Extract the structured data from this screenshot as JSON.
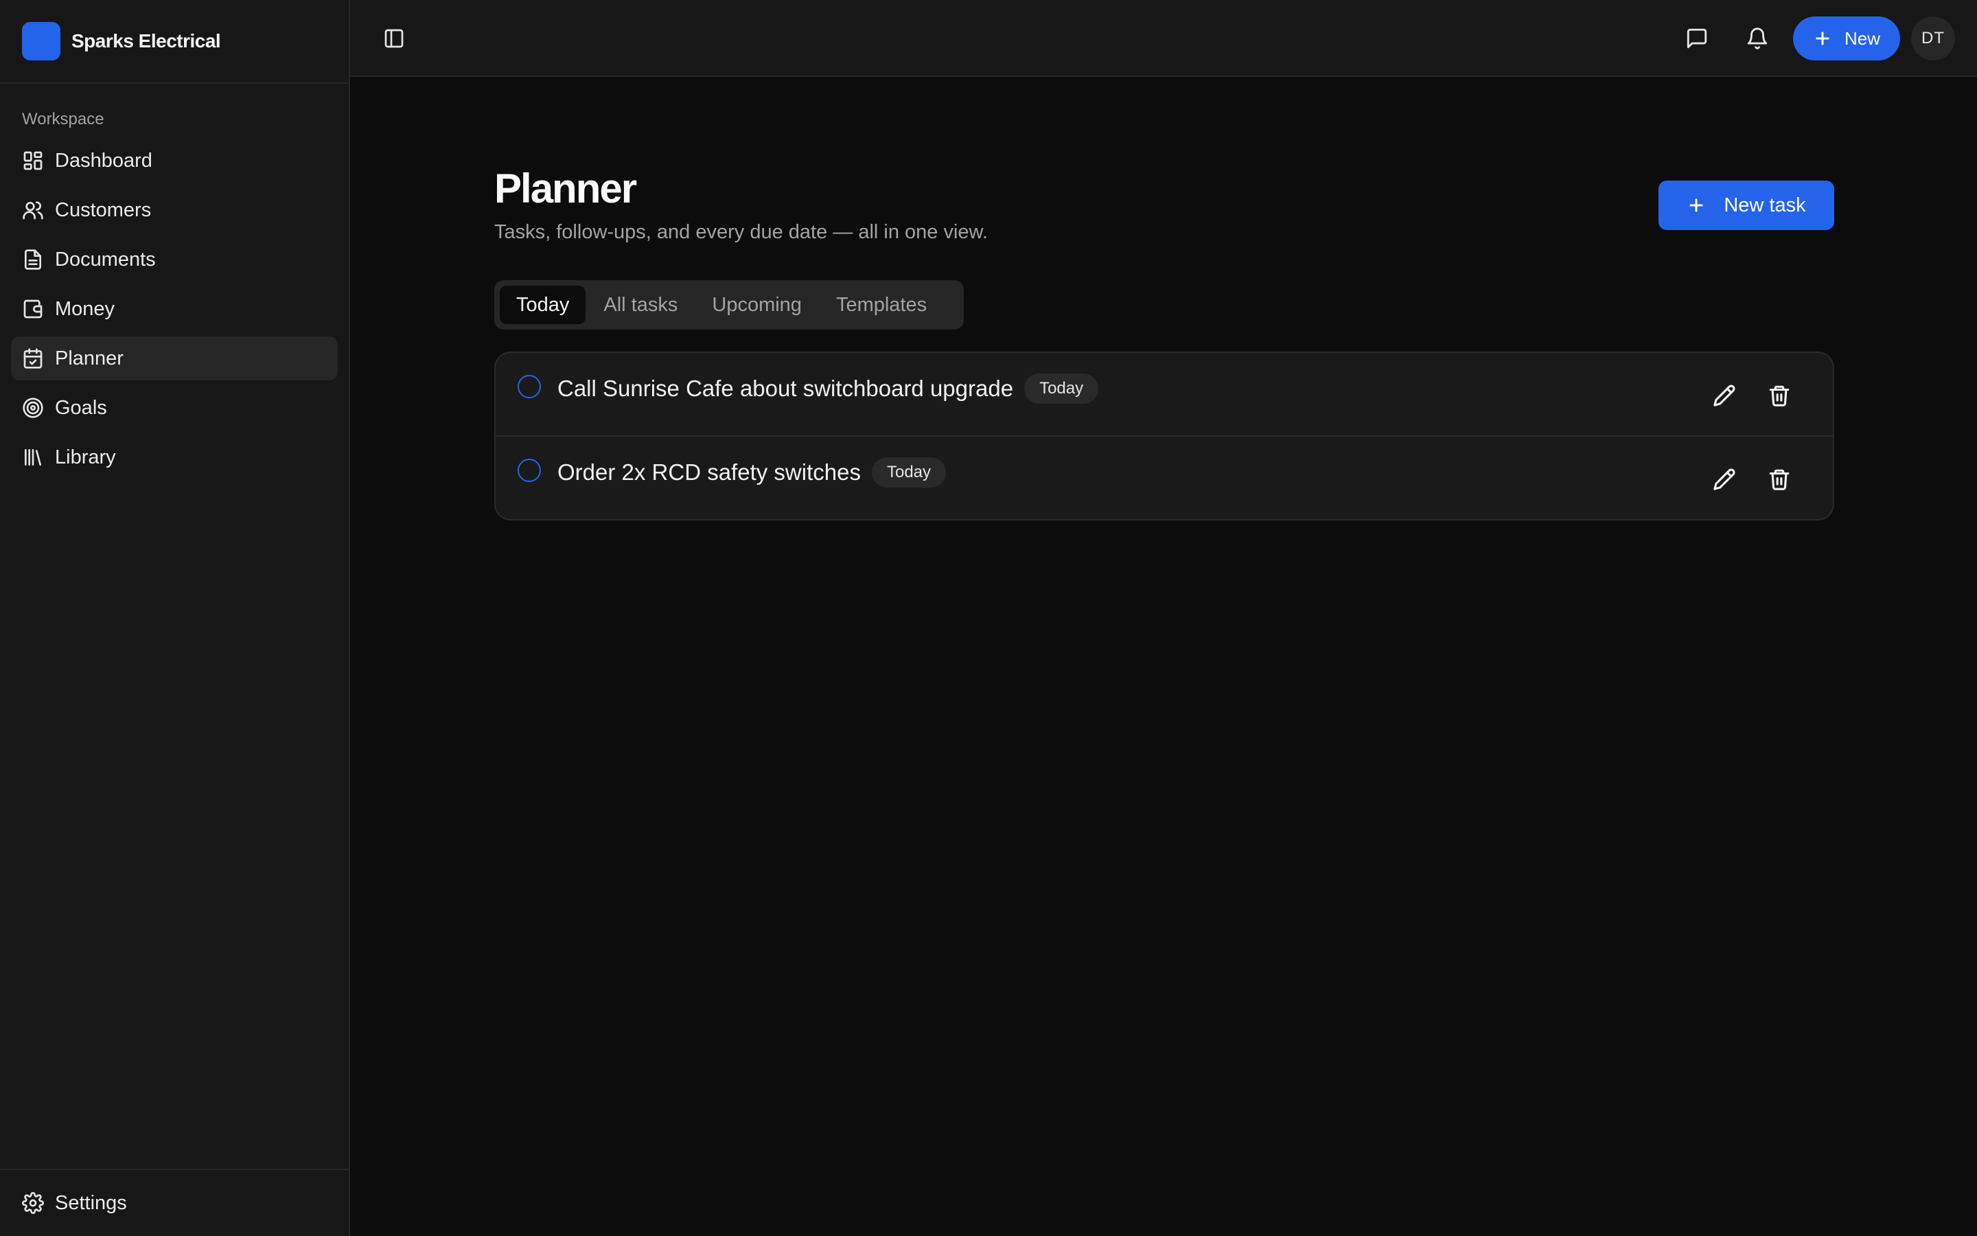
{
  "brand": {
    "name": "Sparks Electrical",
    "accent": "#2563eb"
  },
  "sidebar": {
    "section_label": "Workspace",
    "items": [
      {
        "label": "Dashboard",
        "icon": "dashboard-icon"
      },
      {
        "label": "Customers",
        "icon": "users-icon"
      },
      {
        "label": "Documents",
        "icon": "document-icon"
      },
      {
        "label": "Money",
        "icon": "wallet-icon"
      },
      {
        "label": "Planner",
        "icon": "calendar-check-icon",
        "active": true
      },
      {
        "label": "Goals",
        "icon": "target-icon"
      },
      {
        "label": "Library",
        "icon": "library-icon"
      }
    ],
    "footer": {
      "label": "Settings",
      "icon": "gear-icon"
    }
  },
  "header": {
    "new_label": "New",
    "avatar_initials": "DT",
    "icons": [
      "sidebar-toggle-icon",
      "message-icon",
      "bell-icon",
      "plus-icon"
    ]
  },
  "page": {
    "title": "Planner",
    "subtitle": "Tasks, follow-ups, and every due date — all in one view.",
    "new_task_label": "New task"
  },
  "tabs": [
    {
      "label": "Today",
      "active": true
    },
    {
      "label": "All tasks"
    },
    {
      "label": "Upcoming"
    },
    {
      "label": "Templates"
    }
  ],
  "tasks": [
    {
      "title": "Call Sunrise Cafe about switchboard upgrade",
      "badge": "Today"
    },
    {
      "title": "Order 2x RCD safety switches",
      "badge": "Today"
    }
  ]
}
